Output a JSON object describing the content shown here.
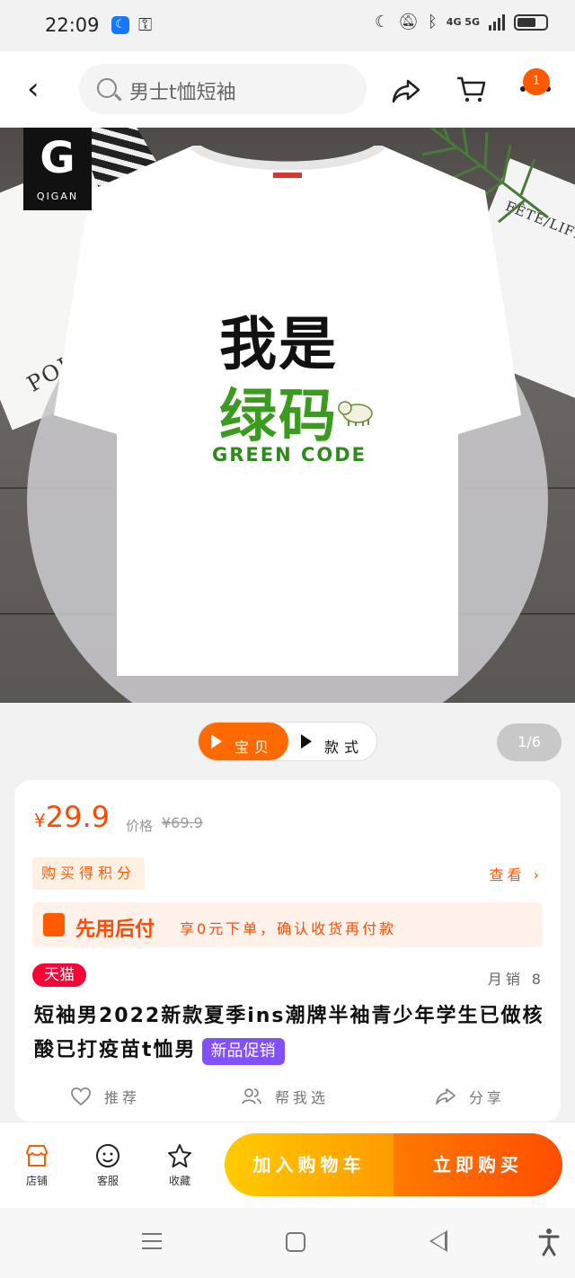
{
  "status_bar": {
    "time": "22:09",
    "network": "4G 5G"
  },
  "nav": {
    "search_text": "男士t恤短袖",
    "cart_badge": "1"
  },
  "hero": {
    "logo_text": "QIGAN",
    "logo_mark": "G",
    "paper_left": "POINR",
    "paper_right": "FÊTE/LIFE",
    "shirt_line1": "我是",
    "shirt_line2": "绿码",
    "shirt_line3": "GREEN CODE"
  },
  "media": {
    "tab_product": "宝贝",
    "tab_style": "款式",
    "page_indicator": "1/6"
  },
  "product": {
    "price_symbol": "¥",
    "price": "29.9",
    "price_label": "价格",
    "original_price": "¥69.9",
    "points_label": "购买得积分",
    "view_link": "查看",
    "paylater_title": "先用后付",
    "paylater_desc": "享0元下单，确认收货再付款",
    "store_badge": "天猫",
    "monthly_sales": "月销 8",
    "title": "短袖男2022新款夏季ins潮牌半袖青少年学生已做核酸已打疫苗t恤男",
    "promo_tag": "新品促销",
    "actions": {
      "recommend": "推荐",
      "help_choose": "帮我选",
      "share": "分享"
    }
  },
  "bottom_bar": {
    "store": "店铺",
    "service": "客服",
    "favorite": "收藏",
    "add_to_cart": "加入购物车",
    "buy_now": "立即购买"
  },
  "colors": {
    "accent": "#ff5a00",
    "tmall_red": "#ff0036",
    "promo_purple": "#8250ff",
    "shirt_green": "#3a9b1f"
  }
}
